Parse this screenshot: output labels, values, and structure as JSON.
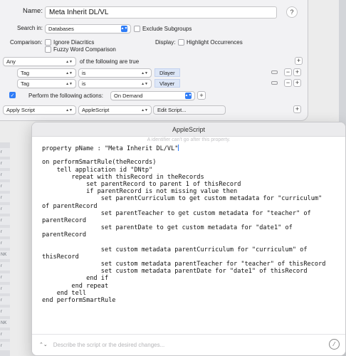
{
  "name_label": "Name:",
  "name_value": "Meta Inherit DL/VL",
  "help_label": "?",
  "search_in_label": "Search in:",
  "search_in_value": "Databases",
  "exclude_subgroups": "Exclude Subgroups",
  "comparison_label": "Comparison:",
  "ignore_diacritics": "Ignore Diacritics",
  "fuzzy_word": "Fuzzy Word Comparison",
  "display_label": "Display:",
  "highlight_occurrences": "Highlight Occurrences",
  "any_value": "Any",
  "any_suffix": "of the following are true",
  "criteria": [
    {
      "field": "Tag",
      "op": "is",
      "value": "Dlayer"
    },
    {
      "field": "Tag",
      "op": "is",
      "value": "Vlayer"
    }
  ],
  "perform_label": "Perform the following actions:",
  "perform_value": "On Demand",
  "action_value": "Apply Script",
  "script_type": "AppleScript",
  "edit_script": "Edit Script...",
  "plus": "+",
  "minus": "−",
  "check": "✓",
  "window_title": "AppleScript",
  "identifier_hint": "A identifier can't go after this property.",
  "code_lines": [
    "property pName : \"Meta Inherit DL/VL\"",
    "",
    "on performSmartRule(theRecords)",
    "    tell application id \"DNtp\"",
    "        repeat with thisRecord in theRecords",
    "            set parentRecord to parent 1 of thisRecord",
    "            if parentRecord is not missing value then",
    "                set parentCurriculum to get custom metadata for \"curriculum\"",
    "of parentRecord",
    "                set parentTeacher to get custom metadata for \"teacher\" of",
    "parentRecord",
    "                set parentDate to get custom metadata for \"date1\" of",
    "parentRecord",
    "",
    "                set custom metadata parentCurriculum for \"curriculum\" of",
    "thisRecord",
    "                set custom metadata parentTeacher for \"teacher\" of thisRecord",
    "                set custom metadata parentDate for \"date1\" of thisRecord",
    "            end if",
    "        end repeat",
    "    end tell",
    "end performSmartRule"
  ],
  "prompt_placeholder": "Describe the script or the desired changes...",
  "list_cells": [
    "r",
    "r",
    "r",
    "r",
    "r",
    "r",
    "r",
    "r",
    "r",
    "NK",
    "r",
    "r",
    "r",
    "r",
    "r",
    "NK",
    "r",
    "r"
  ]
}
